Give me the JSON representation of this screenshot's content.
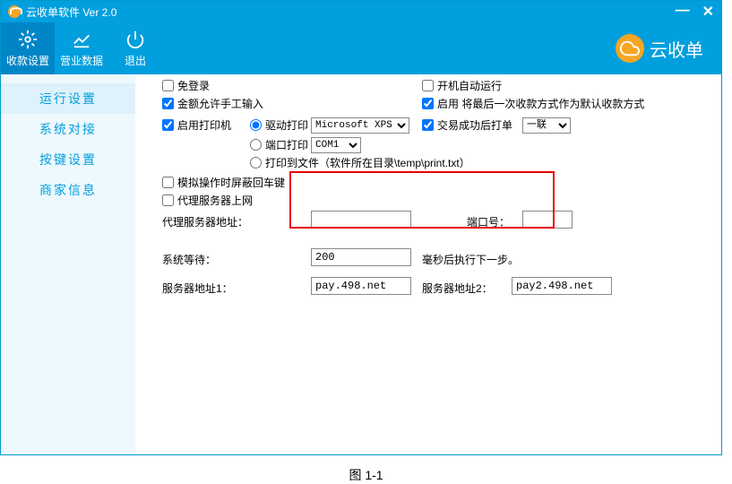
{
  "title": "云收单软件 Ver 2.0",
  "toolbar": {
    "btn1": "收款设置",
    "btn2": "营业数据",
    "btn3": "退出"
  },
  "brand": "云收单",
  "sidebar": {
    "items": [
      {
        "label": "运行设置"
      },
      {
        "label": "系统对接"
      },
      {
        "label": "按键设置"
      },
      {
        "label": "商家信息"
      }
    ]
  },
  "form": {
    "free_login": "免登录",
    "auto_start": "开机自动运行",
    "manual_amount": "金额允许手工输入",
    "enable_default_pay": "启用 将最后一次收款方式作为默认收款方式",
    "enable_printer": "启用打印机",
    "driver_print": "驱动打印",
    "port_print": "端口打印",
    "printer_select": "Microsoft XPS D",
    "com_select": "COM1",
    "trans_print": "交易成功后打单",
    "copy_select": "一联",
    "print_to_file": "打印到文件（软件所在目录\\temp\\print.txt）",
    "mask_enter": "模拟操作时屏蔽回车键",
    "proxy_enable": "代理服务器上网",
    "proxy_addr_label": "代理服务器地址：",
    "port_label": "端口号：",
    "sys_wait_label": "系统等待：",
    "sys_wait_value": "200",
    "sys_wait_suffix": "毫秒后执行下一步。",
    "server1_label": "服务器地址1：",
    "server1_value": "pay.498.net",
    "server2_label": "服务器地址2：",
    "server2_value": "pay2.498.net"
  },
  "checked": {
    "free_login": false,
    "auto_start": false,
    "manual_amount": true,
    "enable_default_pay": true,
    "enable_printer": true,
    "trans_print": true,
    "mask_enter": false,
    "proxy_enable": false,
    "print_mode": "driver"
  },
  "caption": "图 1-1"
}
